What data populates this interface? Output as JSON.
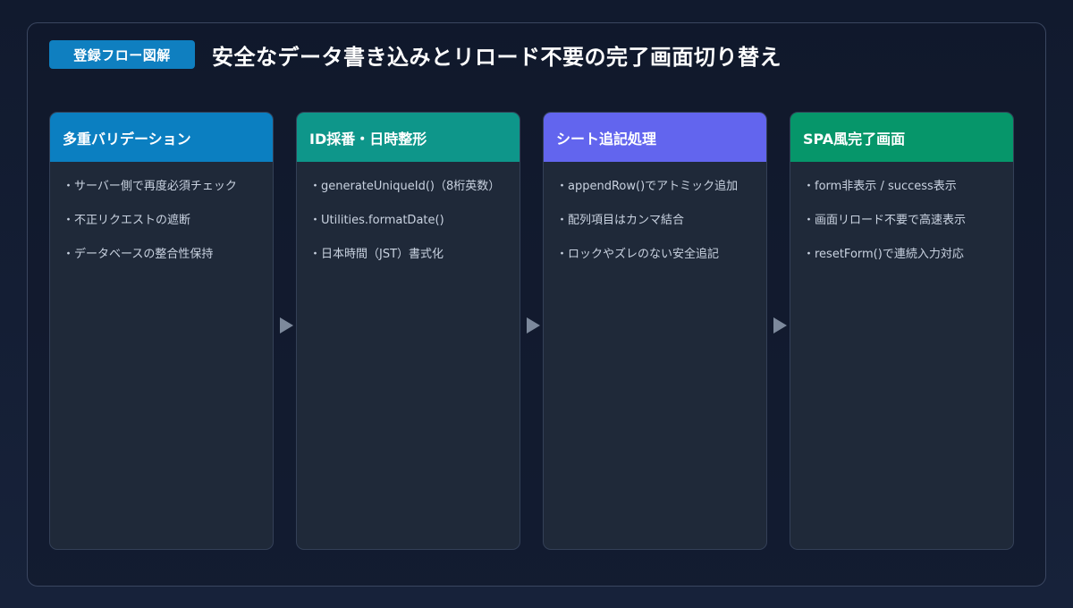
{
  "header": {
    "badge": "登録フロー図解",
    "title": "安全なデータ書き込みとリロード不要の完了画面切り替え"
  },
  "steps": [
    {
      "title": "多重バリデーション",
      "color": "#0b7fc1",
      "items": [
        "・サーバー側で再度必須チェック",
        "・不正リクエストの遮断",
        "・データベースの整合性保持"
      ]
    },
    {
      "title": "ID採番・日時整形",
      "color": "#0e968a",
      "items": [
        "・generateUniqueId()（8桁英数）",
        "・Utilities.formatDate()",
        "・日本時間（JST）書式化"
      ]
    },
    {
      "title": "シート追記処理",
      "color": "#6265ee",
      "items": [
        "・appendRow()でアトミック追加",
        "・配列項目はカンマ結合",
        "・ロックやズレのない安全追記"
      ]
    },
    {
      "title": "SPA風完了画面",
      "color": "#06966a",
      "items": [
        "・form非表示 / success表示",
        "・画面リロード不要で高速表示",
        "・resetForm()で連続入力対応"
      ]
    }
  ]
}
